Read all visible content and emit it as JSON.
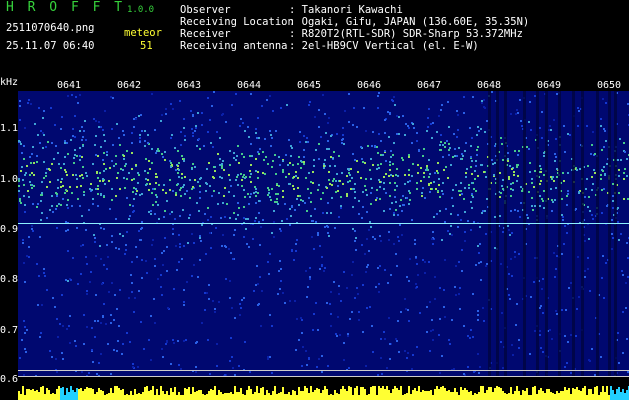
{
  "header": {
    "app_title": "H R O F F T",
    "version": "1.0.0",
    "filename": "2511070640.png",
    "datetime": "25.11.07 06:40",
    "meteor_label": "meteor",
    "meteor_count": "51",
    "info_labels": {
      "observer": "Observer",
      "location": "Receiving Location",
      "receiver": "Receiver",
      "antenna": "Receiving antenna"
    },
    "info_values": {
      "observer": ": Takanori Kawachi",
      "location": ": Ogaki, Gifu, JAPAN (136.60E, 35.35N)",
      "receiver": ": R820T2(RTL-SDR) SDR-Sharp 53.372MHz",
      "antenna": ": 2el-HB9CV Vertical (el. E-W)"
    }
  },
  "axis": {
    "y_unit": "kHz",
    "y_ticks": [
      "1.1",
      "1.0",
      "0.9",
      "0.8",
      "0.7",
      "0.6"
    ],
    "time_ticks": [
      "0641",
      "0642",
      "0643",
      "0644",
      "0645",
      "0646",
      "0647",
      "0648",
      "0649",
      "0650"
    ]
  },
  "colors": {
    "background": "#000000",
    "spectrogram_base": "#000870",
    "title_green": "#36d23c",
    "meteor_line": "#8cf0ff",
    "signal_strip": "#ffff33"
  }
}
